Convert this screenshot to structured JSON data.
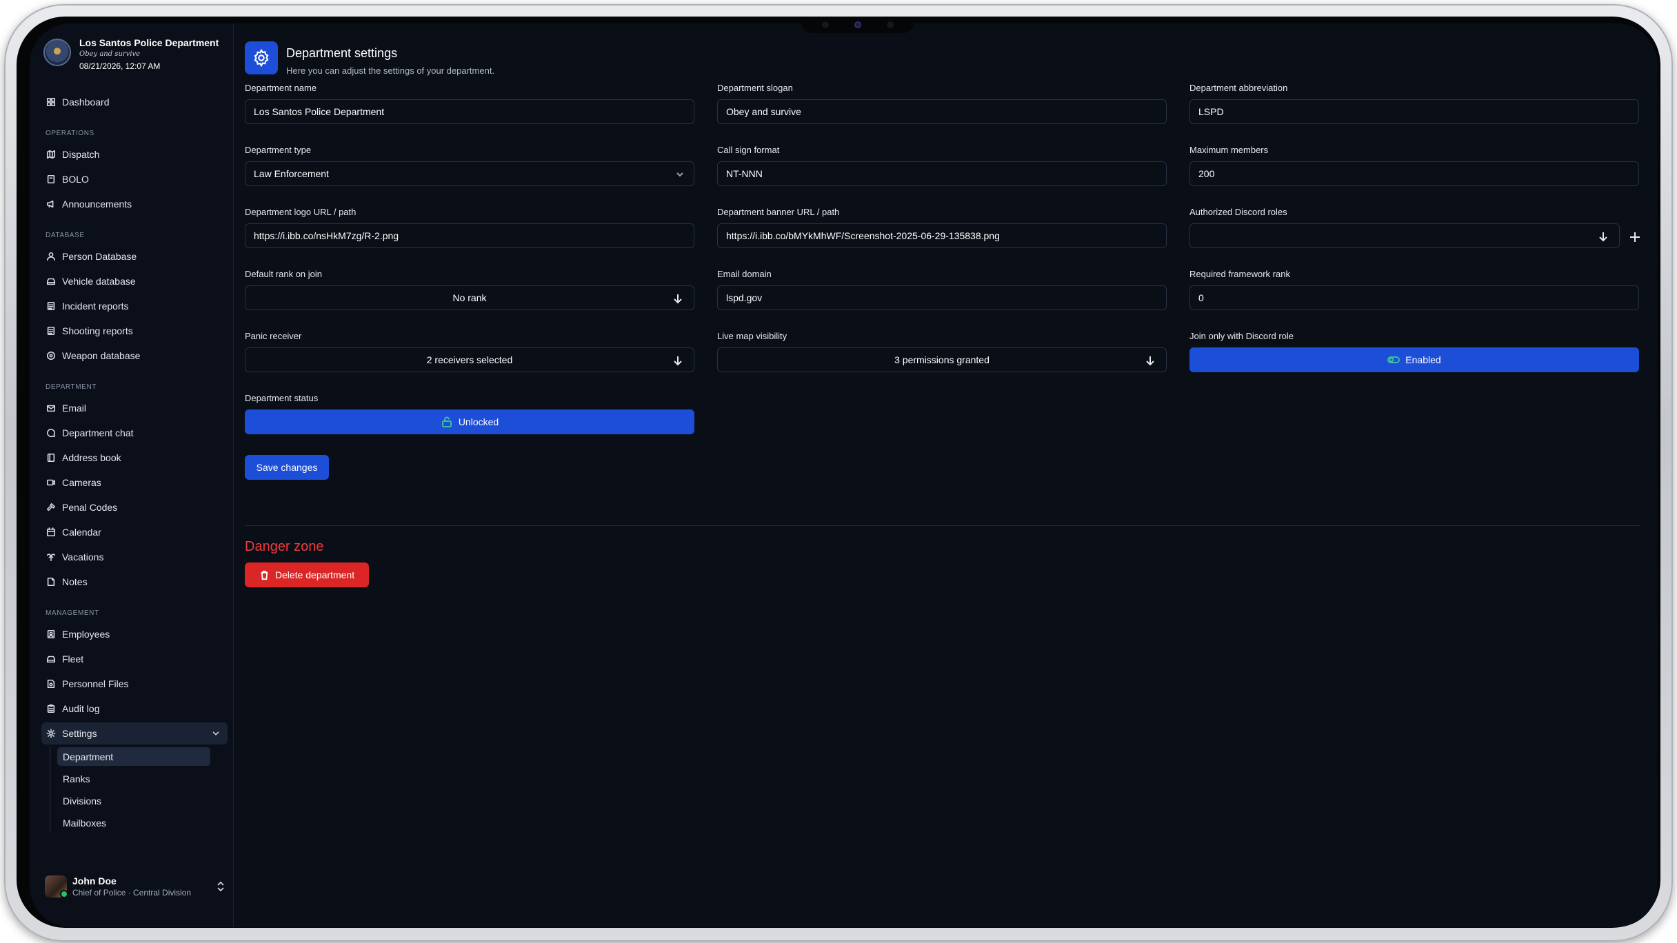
{
  "brand": {
    "name": "Los Santos Police Department",
    "motto": "Obey and survive",
    "datetime": "08/21/2026, 12:07 AM"
  },
  "sidebar": {
    "dashboard": {
      "label": "Dashboard",
      "icon": "dashboard-icon"
    },
    "sections": [
      {
        "title": "OPERATIONS",
        "items": [
          {
            "label": "Dispatch",
            "icon": "map-icon"
          },
          {
            "label": "BOLO",
            "icon": "book-icon"
          },
          {
            "label": "Announcements",
            "icon": "megaphone-icon"
          }
        ]
      },
      {
        "title": "DATABASE",
        "items": [
          {
            "label": "Person Database",
            "icon": "user-icon"
          },
          {
            "label": "Vehicle database",
            "icon": "car-icon"
          },
          {
            "label": "Incident reports",
            "icon": "report-icon"
          },
          {
            "label": "Shooting reports",
            "icon": "report-icon"
          },
          {
            "label": "Weapon database",
            "icon": "target-icon"
          }
        ]
      },
      {
        "title": "DEPARTMENT",
        "items": [
          {
            "label": "Email",
            "icon": "mail-icon"
          },
          {
            "label": "Department chat",
            "icon": "chat-icon"
          },
          {
            "label": "Address book",
            "icon": "addressbook-icon"
          },
          {
            "label": "Cameras",
            "icon": "camera-icon"
          },
          {
            "label": "Penal Codes",
            "icon": "gavel-icon"
          },
          {
            "label": "Calendar",
            "icon": "calendar-icon"
          },
          {
            "label": "Vacations",
            "icon": "palm-icon"
          },
          {
            "label": "Notes",
            "icon": "note-icon"
          }
        ]
      },
      {
        "title": "MANAGEMENT",
        "items": [
          {
            "label": "Employees",
            "icon": "badge-icon"
          },
          {
            "label": "Fleet",
            "icon": "car-icon"
          },
          {
            "label": "Personnel Files",
            "icon": "file-icon"
          },
          {
            "label": "Audit log",
            "icon": "clipboard-icon"
          }
        ]
      }
    ],
    "settings": {
      "label": "Settings",
      "children": [
        "Department",
        "Ranks",
        "Divisions",
        "Mailboxes"
      ],
      "active_child": "Department"
    }
  },
  "user": {
    "name": "John Doe",
    "role": "Chief of Police · Central Division"
  },
  "page": {
    "title": "Department settings",
    "subtitle": "Here you can adjust the settings of your department."
  },
  "form": {
    "department_name": {
      "label": "Department name",
      "value": "Los Santos Police Department"
    },
    "department_slogan": {
      "label": "Department slogan",
      "value": "Obey and survive"
    },
    "department_abbreviation": {
      "label": "Department abbreviation",
      "value": "LSPD"
    },
    "department_type": {
      "label": "Department type",
      "value": "Law Enforcement"
    },
    "call_sign_format": {
      "label": "Call sign format",
      "value": "NT-NNN"
    },
    "maximum_members": {
      "label": "Maximum members",
      "value": "200"
    },
    "logo_url": {
      "label": "Department logo URL / path",
      "value": "https://i.ibb.co/nsHkM7zg/R-2.png"
    },
    "banner_url": {
      "label": "Department banner URL / path",
      "value": "https://i.ibb.co/bMYkMhWF/Screenshot-2025-06-29-135838.png"
    },
    "discord_roles": {
      "label": "Authorized Discord roles",
      "value": ""
    },
    "default_rank": {
      "label": "Default rank on join",
      "value": "No rank"
    },
    "email_domain": {
      "label": "Email domain",
      "value": "lspd.gov"
    },
    "framework_rank": {
      "label": "Required framework rank",
      "value": "0"
    },
    "panic_receiver": {
      "label": "Panic receiver",
      "value": "2 receivers selected"
    },
    "live_map": {
      "label": "Live map visibility",
      "value": "3 permissions granted"
    },
    "discord_join": {
      "label": "Join only with Discord role",
      "value": "Enabled"
    },
    "status": {
      "label": "Department status",
      "value": "Unlocked"
    }
  },
  "actions": {
    "save": "Save changes",
    "danger_title": "Danger zone",
    "delete": "Delete department"
  },
  "colors": {
    "background": "#0a0e17",
    "accent": "#1d4ed8",
    "danger": "#dc2626",
    "toggle_on": "#3ec99b"
  }
}
